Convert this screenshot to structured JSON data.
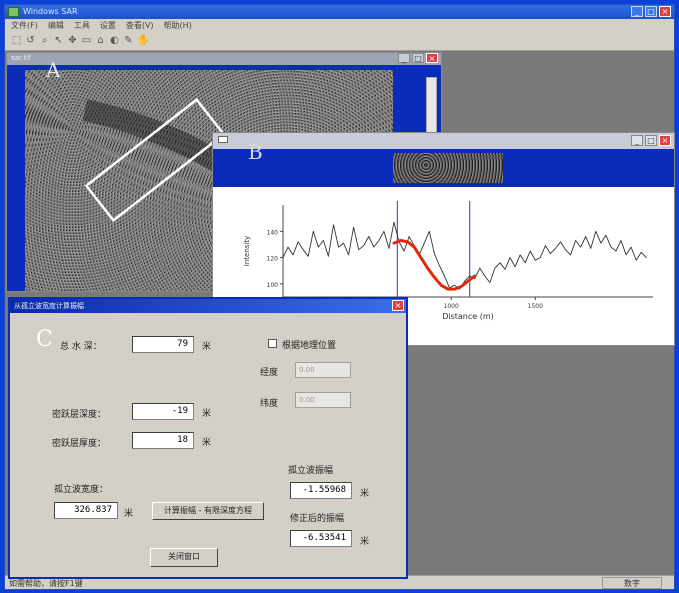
{
  "app": {
    "title": "Windows SAR",
    "menu": [
      "文件(F)",
      "编辑",
      "工具",
      "设置",
      "查看(V)",
      "帮助(H)"
    ],
    "status_text": "如需帮助，请按F1键",
    "status_right": "数字"
  },
  "panel_labels": {
    "a": "A",
    "b": "B",
    "c": "C"
  },
  "winA": {
    "title": "sar.tif"
  },
  "chart_data": {
    "type": "line",
    "xlabel": "Distance (m)",
    "ylabel": "Intensity",
    "xlim": [
      0,
      2200
    ],
    "ylim": [
      90,
      160
    ],
    "xticks": [
      1000,
      1500
    ],
    "yticks": [
      100,
      120,
      140
    ],
    "vlines": [
      680,
      1110
    ],
    "series": [
      {
        "color": "#333333",
        "x": [
          0,
          30,
          60,
          90,
          120,
          150,
          180,
          210,
          240,
          270,
          300,
          330,
          360,
          390,
          420,
          450,
          480,
          510,
          540,
          570,
          600,
          630,
          660,
          690,
          720,
          750,
          780,
          810,
          840,
          870,
          900,
          930,
          960,
          990,
          1020,
          1050,
          1080,
          1110,
          1140,
          1170,
          1200,
          1230,
          1260,
          1290,
          1320,
          1350,
          1380,
          1410,
          1440,
          1470,
          1500,
          1530,
          1560,
          1590,
          1620,
          1650,
          1680,
          1710,
          1740,
          1770,
          1800,
          1830,
          1860,
          1890,
          1920,
          1950,
          1980,
          2010,
          2040,
          2070,
          2100,
          2130,
          2160
        ],
        "values": [
          120,
          128,
          122,
          132,
          126,
          121,
          140,
          128,
          133,
          121,
          145,
          128,
          131,
          122,
          143,
          126,
          129,
          136,
          128,
          133,
          140,
          127,
          147,
          132,
          125,
          136,
          129,
          122,
          131,
          140,
          123,
          114,
          106,
          97,
          99,
          96,
          102,
          106,
          104,
          112,
          106,
          101,
          112,
          116,
          111,
          120,
          113,
          122,
          116,
          125,
          118,
          120,
          129,
          123,
          127,
          132,
          126,
          122,
          133,
          128,
          136,
          127,
          140,
          131,
          137,
          128,
          125,
          133,
          122,
          128,
          118,
          124,
          120
        ]
      },
      {
        "color": "#e02a10",
        "x": [
          660,
          700,
          740,
          780,
          820,
          860,
          900,
          940,
          980,
          1020,
          1060,
          1100,
          1140
        ],
        "values": [
          131,
          133,
          132,
          128,
          120,
          112,
          105,
          99,
          96,
          96,
          98,
          102,
          106
        ]
      }
    ]
  },
  "dialog": {
    "title": "从孤立波宽度计算振幅",
    "total_depth_label": "总 水 深：",
    "total_depth": "79",
    "unit_m": "米",
    "checkbox_label": "根据地理位置",
    "lon_label": "经度",
    "lon_placeholder": "0.00",
    "lat_label": "纬度",
    "lat_placeholder": "0.00",
    "thermocline_depth_label": "密跃层深度：",
    "thermocline_depth": "-19",
    "thermocline_thickness_label": "密跃层厚度：",
    "thermocline_thickness": "18",
    "wave_width_label": "孤立波宽度：",
    "wave_width": "326.837",
    "calc_button": "计算振幅 - 有限深度方程",
    "amplitude_label": "孤立波振幅",
    "amplitude": "-1.55968",
    "corrected_amplitude_label": "修正后的振幅",
    "corrected_amplitude": "-6.53541",
    "close_button": "关闭窗口"
  }
}
